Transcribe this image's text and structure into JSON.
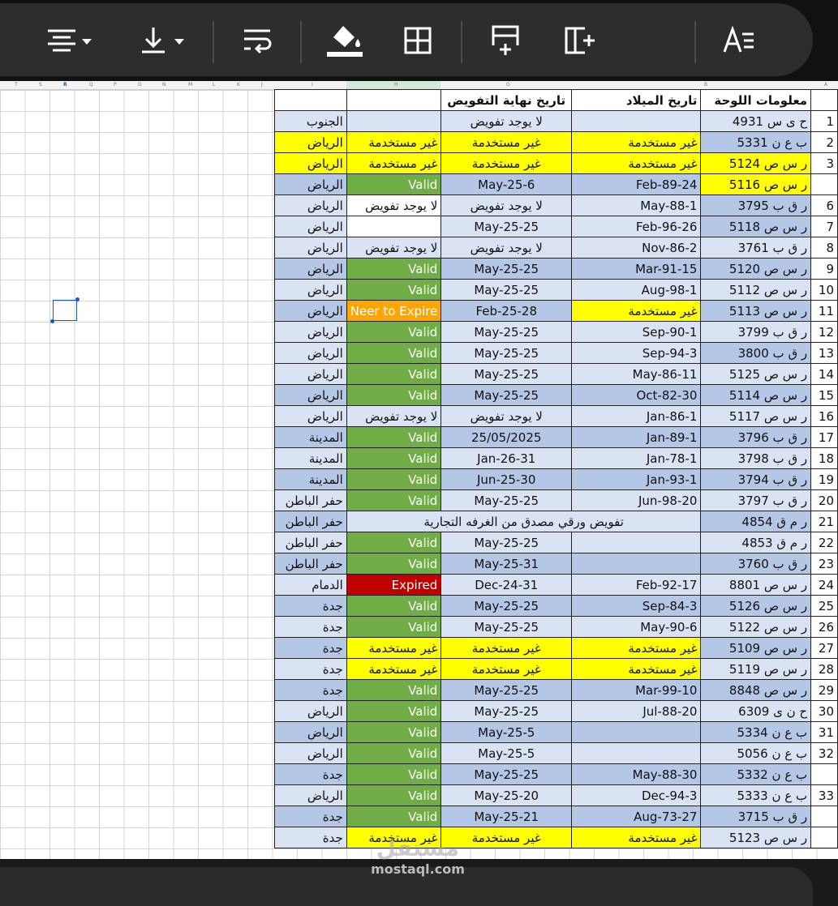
{
  "toolbar": {
    "buttons": [
      {
        "name": "align-horizontal-button",
        "icon": "align-center-icon"
      },
      {
        "name": "align-vertical-button",
        "icon": "align-bottom-icon"
      },
      {
        "name": "text-wrap-button",
        "icon": "wrap-text-icon"
      },
      {
        "name": "fill-color-button",
        "icon": "paint-bucket-icon"
      },
      {
        "name": "borders-button",
        "icon": "borders-icon"
      },
      {
        "name": "insert-row-button",
        "icon": "insert-row-icon"
      },
      {
        "name": "insert-column-button",
        "icon": "insert-column-icon"
      },
      {
        "name": "text-format-button",
        "icon": "text-format-icon"
      }
    ]
  },
  "column_letters": [
    "T",
    "S",
    "R",
    "Q",
    "P",
    "O",
    "N",
    "M",
    "L",
    "K",
    "J",
    "I",
    "H",
    "G",
    "",
    "B",
    "A"
  ],
  "selected_column": "R",
  "headers": {
    "plate": "معلومات اللوحة",
    "birth": "تاريخ الميلاد",
    "end": "تاريخ نهاية التفويض"
  },
  "rows": [
    {
      "n": "1",
      "plate": "ح ى س 4931",
      "birth": "",
      "end": "لا يوجد تفويض",
      "status": "",
      "city": "الجنوب",
      "pc": "lblue",
      "bc": "lblue",
      "ec": "lblue",
      "sc": "lblue",
      "cc": "lblue"
    },
    {
      "n": "2",
      "plate": "ب ع ن 5331",
      "birth": "غير مستخدمة",
      "end": "غير مستخدمة",
      "status": "غير مستخدمة",
      "city": "الرياض",
      "pc": "blue",
      "bc": "yellow",
      "ec": "yellow",
      "sc": "yellow",
      "cc": "yellow"
    },
    {
      "n": "3",
      "plate": "ر س ص 5124",
      "birth": "غير مستخدمة",
      "end": "غير مستخدمة",
      "status": "غير مستخدمة",
      "city": "الرياض",
      "pc": "yellow",
      "bc": "yellow",
      "ec": "yellow",
      "sc": "yellow",
      "cc": "yellow"
    },
    {
      "n": "",
      "plate": "ر س ص 5116",
      "birth": "Feb-89-24",
      "end": "May-25-6",
      "status": "Valid",
      "city": "الرياض",
      "pc": "yellow",
      "bc": "blue",
      "ec": "blue",
      "sc": "green",
      "cc": "blue"
    },
    {
      "n": "6",
      "plate": "ر ق ب 3795",
      "birth": "May-88-1",
      "end": "لا يوجد تفويض",
      "status": "لا يوجد تفويض",
      "city": "الرياض",
      "pc": "blue",
      "bc": "lblue",
      "ec": "lblue",
      "sc": "white",
      "cc": "lblue"
    },
    {
      "n": "7",
      "plate": "ر س ص 5118",
      "birth": "Feb-96-26",
      "end": "May-25-25",
      "status": "",
      "city": "الرياض",
      "pc": "blue",
      "bc": "lblue",
      "ec": "lblue",
      "sc": "white",
      "cc": "lblue"
    },
    {
      "n": "8",
      "plate": "ر ق ب 3761",
      "birth": "Nov-86-2",
      "end": "لا يوجد تفويض",
      "status": "لا يوجد تفويض",
      "city": "الرياض",
      "pc": "lblue",
      "bc": "lblue",
      "ec": "lblue",
      "sc": "lblue",
      "cc": "lblue"
    },
    {
      "n": "9",
      "plate": "ر س ص 5120",
      "birth": "Mar-91-15",
      "end": "May-25-25",
      "status": "Valid",
      "city": "الرياض",
      "pc": "blue",
      "bc": "blue",
      "ec": "blue",
      "sc": "green",
      "cc": "blue"
    },
    {
      "n": "10",
      "plate": "ر س ص 5112",
      "birth": "Aug-98-1",
      "end": "May-25-25",
      "status": "Valid",
      "city": "الرياض",
      "pc": "lblue",
      "bc": "lblue",
      "ec": "lblue",
      "sc": "green",
      "cc": "lblue"
    },
    {
      "n": "11",
      "plate": "ر س ص 5113",
      "birth": "غير مستخدمة",
      "end": "Feb-25-28",
      "status": "Neer to Expire",
      "city": "الرياض",
      "pc": "blue",
      "bc": "yellow",
      "ec": "blue",
      "sc": "orange",
      "cc": "blue"
    },
    {
      "n": "12",
      "plate": "ر ق ب 3799",
      "birth": "Sep-90-1",
      "end": "May-25-25",
      "status": "Valid",
      "city": "الرياض",
      "pc": "lblue",
      "bc": "lblue",
      "ec": "lblue",
      "sc": "green",
      "cc": "lblue"
    },
    {
      "n": "13",
      "plate": "ر ق ب 3800",
      "birth": "Sep-94-3",
      "end": "May-25-25",
      "status": "Valid",
      "city": "الرياض",
      "pc": "blue",
      "bc": "lblue",
      "ec": "lblue",
      "sc": "green",
      "cc": "lblue"
    },
    {
      "n": "14",
      "plate": "ر س ص 5125",
      "birth": "May-86-11",
      "end": "May-25-25",
      "status": "Valid",
      "city": "الرياض",
      "pc": "lblue",
      "bc": "lblue",
      "ec": "lblue",
      "sc": "green",
      "cc": "lblue"
    },
    {
      "n": "15",
      "plate": "ر س ص 5114",
      "birth": "Oct-82-30",
      "end": "May-25-25",
      "status": "Valid",
      "city": "الرياض",
      "pc": "blue",
      "bc": "blue",
      "ec": "blue",
      "sc": "green",
      "cc": "blue"
    },
    {
      "n": "16",
      "plate": "ر س ص 5117",
      "birth": "Jan-86-1",
      "end": "لا يوجد تفويض",
      "status": "لا يوجد تفويض",
      "city": "الرياض",
      "pc": "lblue",
      "bc": "lblue",
      "ec": "lblue",
      "sc": "lblue",
      "cc": "lblue"
    },
    {
      "n": "17",
      "plate": "ر ق ب 3796",
      "birth": "Jan-89-1",
      "end": "25/05/2025",
      "status": "Valid",
      "city": "المدينة",
      "pc": "blue",
      "bc": "blue",
      "ec": "blue",
      "sc": "green",
      "cc": "blue"
    },
    {
      "n": "18",
      "plate": "ر ق ب 3798",
      "birth": "Jan-78-1",
      "end": "Jan-26-31",
      "status": "Valid",
      "city": "المدينة",
      "pc": "lblue",
      "bc": "lblue",
      "ec": "lblue",
      "sc": "green",
      "cc": "lblue"
    },
    {
      "n": "19",
      "plate": "ر ق ب 3794",
      "birth": "Jan-93-1",
      "end": "Jun-25-30",
      "status": "Valid",
      "city": "المدينة",
      "pc": "blue",
      "bc": "blue",
      "ec": "blue",
      "sc": "green",
      "cc": "blue"
    },
    {
      "n": "20",
      "plate": "ر ق ب 3797",
      "birth": "Jun-98-20",
      "end": "May-25-25",
      "status": "Valid",
      "city": "حفر الباطن",
      "pc": "lblue",
      "bc": "lblue",
      "ec": "lblue",
      "sc": "green",
      "cc": "lblue"
    },
    {
      "n": "21",
      "plate": "ر م ق 4854",
      "birth": "",
      "end": "",
      "status": "",
      "city": "حفر الباطن",
      "merged": "تفويض ورقي مصدق من الغرفه التجارية",
      "pc": "blue",
      "bc": "blue",
      "ec": "blue",
      "sc": "blue",
      "cc": "blue"
    },
    {
      "n": "22",
      "plate": "ر م ق 4853",
      "birth": "",
      "end": "May-25-25",
      "status": "Valid",
      "city": "حفر الباطن",
      "pc": "lblue",
      "bc": "lblue",
      "ec": "lblue",
      "sc": "green",
      "cc": "lblue"
    },
    {
      "n": "23",
      "plate": "ر ق ب 3760",
      "birth": "",
      "end": "May-25-31",
      "status": "Valid",
      "city": "حفر الباطن",
      "pc": "blue",
      "bc": "blue",
      "ec": "blue",
      "sc": "green",
      "cc": "blue"
    },
    {
      "n": "24",
      "plate": "ر س ص 8801",
      "birth": "Feb-92-17",
      "end": "Dec-24-31",
      "status": "Expired",
      "city": "الدمام",
      "pc": "lblue",
      "bc": "lblue",
      "ec": "lblue",
      "sc": "red",
      "cc": "lblue"
    },
    {
      "n": "25",
      "plate": "ر س ص 5126",
      "birth": "Sep-84-3",
      "end": "May-25-25",
      "status": "Valid",
      "city": "جدة",
      "pc": "blue",
      "bc": "blue",
      "ec": "blue",
      "sc": "green",
      "cc": "blue"
    },
    {
      "n": "26",
      "plate": "ر س ص 5122",
      "birth": "May-90-6",
      "end": "May-25-25",
      "status": "Valid",
      "city": "جدة",
      "pc": "lblue",
      "bc": "lblue",
      "ec": "lblue",
      "sc": "green",
      "cc": "lblue"
    },
    {
      "n": "27",
      "plate": "ر س ص 5109",
      "birth": "غير مستخدمة",
      "end": "غير مستخدمة",
      "status": "غير مستخدمة",
      "city": "جدة",
      "pc": "blue",
      "bc": "yellow",
      "ec": "yellow",
      "sc": "yellow",
      "cc": "blue"
    },
    {
      "n": "28",
      "plate": "ر س ص 5119",
      "birth": "غير مستخدمة",
      "end": "غير مستخدمة",
      "status": "غير مستخدمة",
      "city": "جدة",
      "pc": "lblue",
      "bc": "yellow",
      "ec": "yellow",
      "sc": "yellow",
      "cc": "lblue"
    },
    {
      "n": "29",
      "plate": "ر س ص 8848",
      "birth": "Mar-99-10",
      "end": "May-25-25",
      "status": "Valid",
      "city": "جدة",
      "pc": "blue",
      "bc": "blue",
      "ec": "blue",
      "sc": "green",
      "cc": "blue"
    },
    {
      "n": "30",
      "plate": "ح ن ى 6309",
      "birth": "Jul-88-20",
      "end": "May-25-25",
      "status": "Valid",
      "city": "الرياض",
      "pc": "lblue",
      "bc": "lblue",
      "ec": "lblue",
      "sc": "green",
      "cc": "lblue"
    },
    {
      "n": "31",
      "plate": "ب ع ن 5334",
      "birth": "",
      "end": "May-25-5",
      "status": "Valid",
      "city": "الرياض",
      "pc": "blue",
      "bc": "blue",
      "ec": "blue",
      "sc": "green",
      "cc": "blue"
    },
    {
      "n": "32",
      "plate": "ب ع ن 5056",
      "birth": "",
      "end": "May-25-5",
      "status": "Valid",
      "city": "الرياض",
      "pc": "lblue",
      "bc": "lblue",
      "ec": "lblue",
      "sc": "green",
      "cc": "lblue"
    },
    {
      "n": "",
      "plate": "ب ع ن 5332",
      "birth": "May-88-30",
      "end": "May-25-25",
      "status": "Valid",
      "city": "جدة",
      "pc": "blue",
      "bc": "blue",
      "ec": "blue",
      "sc": "green",
      "cc": "blue"
    },
    {
      "n": "33",
      "plate": "ب ع ن 5333",
      "birth": "Dec-94-3",
      "end": "May-25-20",
      "status": "Valid",
      "city": "الرياض",
      "pc": "lblue",
      "bc": "lblue",
      "ec": "lblue",
      "sc": "green",
      "cc": "lblue"
    },
    {
      "n": "",
      "plate": "ر ق ب 3715",
      "birth": "Aug-73-27",
      "end": "May-25-21",
      "status": "Valid",
      "city": "جدة",
      "pc": "blue",
      "bc": "blue",
      "ec": "blue",
      "sc": "green",
      "cc": "blue"
    },
    {
      "n": "",
      "plate": "ر س ص 5123",
      "birth": "غير مستخدمة",
      "end": "غير مستخدمة",
      "status": "غير مستخدمة",
      "city": "جدة",
      "pc": "lblue",
      "bc": "yellow",
      "ec": "yellow",
      "sc": "yellow",
      "cc": "lblue"
    }
  ],
  "watermark": {
    "arabic": "مستقل",
    "latin": "mostaql.com"
  }
}
